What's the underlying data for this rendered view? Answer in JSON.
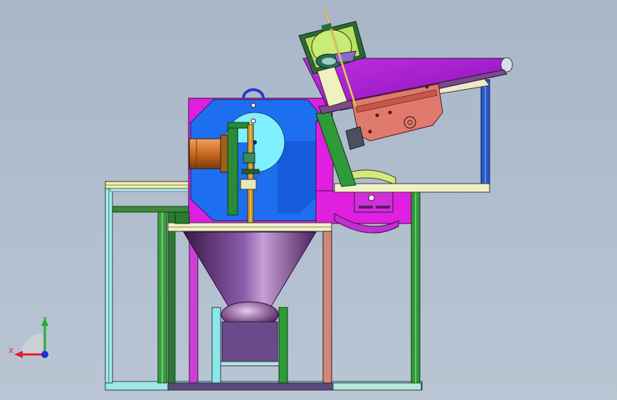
{
  "viewport": {
    "title": "",
    "background_top": "#a8b6c8",
    "background_bottom": "#b9c5d3"
  },
  "model": {
    "parts": [
      "left-frame",
      "top-rail",
      "hopper-platform",
      "cone-hopper",
      "collection-box",
      "drum-housing",
      "drive-motor",
      "vertical-shaft",
      "inclined-feeder-chute",
      "feeder-vibrator-motor",
      "top-gear-assembly",
      "right-frame",
      "base-frame"
    ],
    "colors": {
      "housing": "#e020e0",
      "drum": "#1e6ff0",
      "drum_inner": "#6fe8ff",
      "motor": "#d07a2a",
      "cone": "#8a4aa0",
      "chute": "#b020d8",
      "feeder_motor": "#e07a6e",
      "gear_housing": "#8ab848",
      "frame_green": "#2e9a3a",
      "frame_cyan": "#7fe6e6",
      "frame_salmon": "#d08878",
      "frame_blue": "#2a4ad0"
    }
  },
  "triad": {
    "x_label": "X",
    "y_label": "Y",
    "x_color": "#e0202a",
    "y_color": "#20b030",
    "z_color": "#2030d0"
  }
}
